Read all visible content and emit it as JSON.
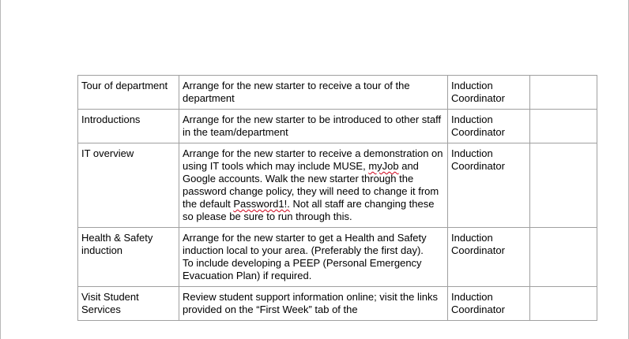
{
  "rows": [
    {
      "activity": "Tour of department",
      "action": "Arrange for the new starter to receive a tour of the department",
      "owner": "Induction Coordinator",
      "status": ""
    },
    {
      "activity": "Introductions",
      "action": "Arrange for the new starter to be introduced to other staff in the team/department",
      "owner": "Induction Coordinator",
      "status": ""
    },
    {
      "activity": "IT overview",
      "action_parts": {
        "p1": "Arrange for the new starter to receive a demonstration on using IT tools which may include MUSE, ",
        "p2": "myJob",
        "p3": " and Google accounts. Walk the new starter through the password change policy, they will need to change it from the default ",
        "p4": "Password1!.",
        "p5": " Not all staff are changing these so please be sure to run through this."
      },
      "owner": "Induction Coordinator",
      "status": ""
    },
    {
      "activity": "Health & Safety induction",
      "action_lines": [
        "Arrange for the new starter to get a Health and Safety induction local to your area. (Preferably the first day).",
        "To include developing a PEEP (Personal Emergency Evacuation Plan) if required."
      ],
      "owner": "Induction Coordinator",
      "status": ""
    },
    {
      "activity": "Visit Student Services",
      "action": "Review student support information online; visit the links provided on the “First Week” tab of the",
      "owner": "Induction Coordinator",
      "status": ""
    }
  ],
  "colors": {
    "border": "#a0a0a0",
    "spellcheck": "#d0021b",
    "page_edge": "#b8b8b8"
  }
}
